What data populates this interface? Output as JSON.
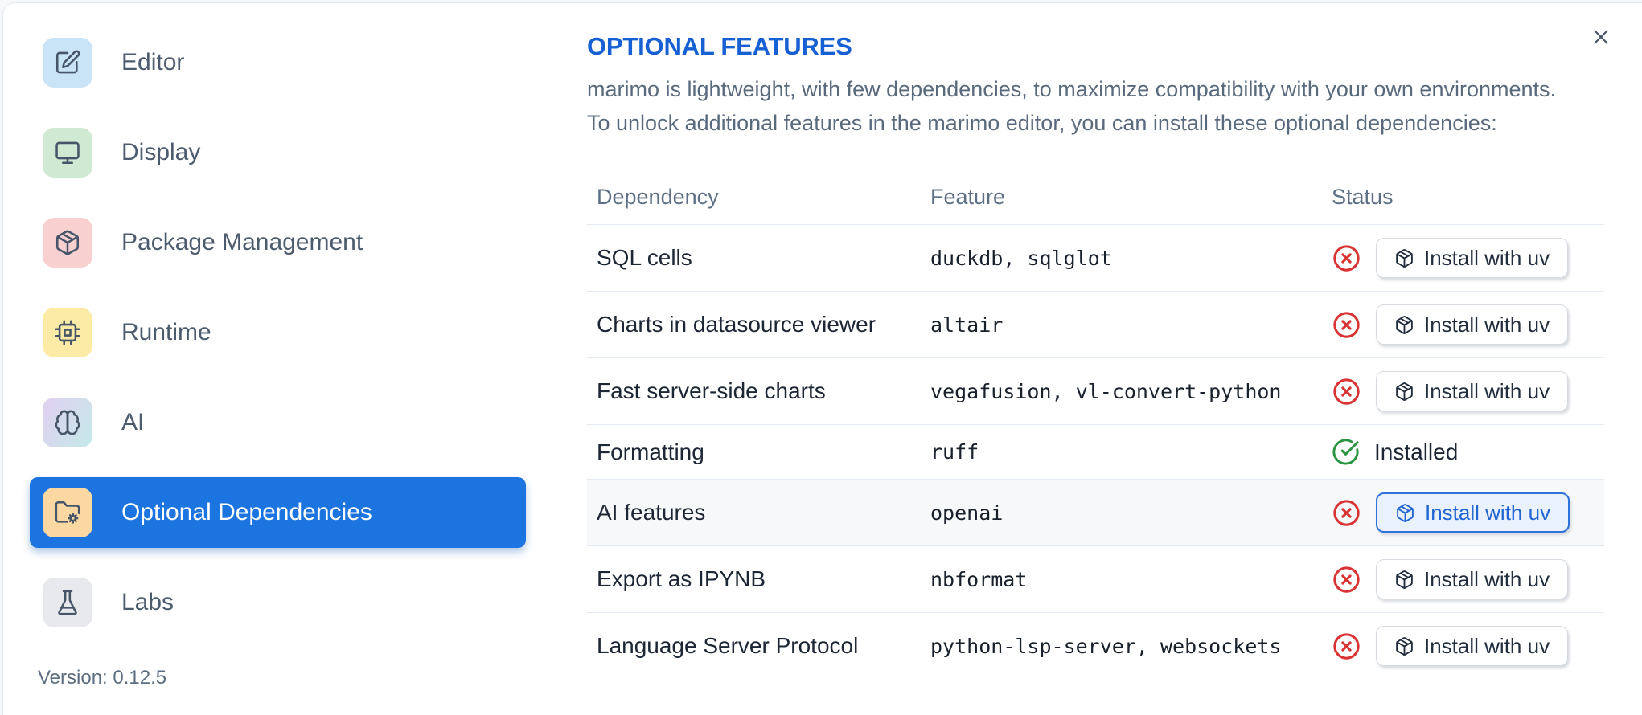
{
  "sidebar": {
    "items": [
      {
        "label": "Editor",
        "icon": "editor",
        "tile_bg": "#c9e3f7",
        "active": false
      },
      {
        "label": "Display",
        "icon": "display",
        "tile_bg": "#cfe9d2",
        "active": false
      },
      {
        "label": "Package Management",
        "icon": "package",
        "tile_bg": "#f9d0d0",
        "active": false
      },
      {
        "label": "Runtime",
        "icon": "runtime",
        "tile_bg": "#fbeba6",
        "active": false
      },
      {
        "label": "AI",
        "icon": "brain",
        "tile_bg": "linear-gradient(120deg,#ded2f0 10%,#c8e7ea 90%)",
        "active": false
      },
      {
        "label": "Optional Dependencies",
        "icon": "folder-cog",
        "tile_bg": "#fbd8a2",
        "active": true
      },
      {
        "label": "Labs",
        "icon": "flask",
        "tile_bg": "#e7e9ed",
        "active": false
      }
    ],
    "version": "Version: 0.12.5"
  },
  "content": {
    "title": "OPTIONAL FEATURES",
    "description_line1": "marimo is lightweight, with few dependencies, to maximize compatibility with your own environments.",
    "description_line2": "To unlock additional features in the marimo editor, you can install these optional dependencies:",
    "table": {
      "columns": [
        "Dependency",
        "Feature",
        "Status"
      ],
      "install_button_label": "Install with uv",
      "installed_label": "Installed",
      "rows": [
        {
          "dependency": "SQL cells",
          "feature": "duckdb, sqlglot",
          "status": "missing",
          "highlighted": false
        },
        {
          "dependency": "Charts in datasource viewer",
          "feature": "altair",
          "status": "missing",
          "highlighted": false
        },
        {
          "dependency": "Fast server-side charts",
          "feature": "vegafusion, vl-convert-python",
          "status": "missing",
          "highlighted": false
        },
        {
          "dependency": "Formatting",
          "feature": "ruff",
          "status": "installed",
          "highlighted": false
        },
        {
          "dependency": "AI features",
          "feature": "openai",
          "status": "missing",
          "highlighted": true
        },
        {
          "dependency": "Export as IPYNB",
          "feature": "nbformat",
          "status": "missing",
          "highlighted": false
        },
        {
          "dependency": "Language Server Protocol",
          "feature": "python-lsp-server, websockets",
          "status": "missing",
          "highlighted": false
        }
      ]
    }
  },
  "colors": {
    "accent_blue": "#1b74e0",
    "title_blue": "#1660d3",
    "status_red": "#d93333",
    "status_green": "#2a9440",
    "highlight_button_blue": "#2d73da",
    "row_highlight_bg": "#f7f8f9",
    "border_gray": "#e4eaf1"
  }
}
